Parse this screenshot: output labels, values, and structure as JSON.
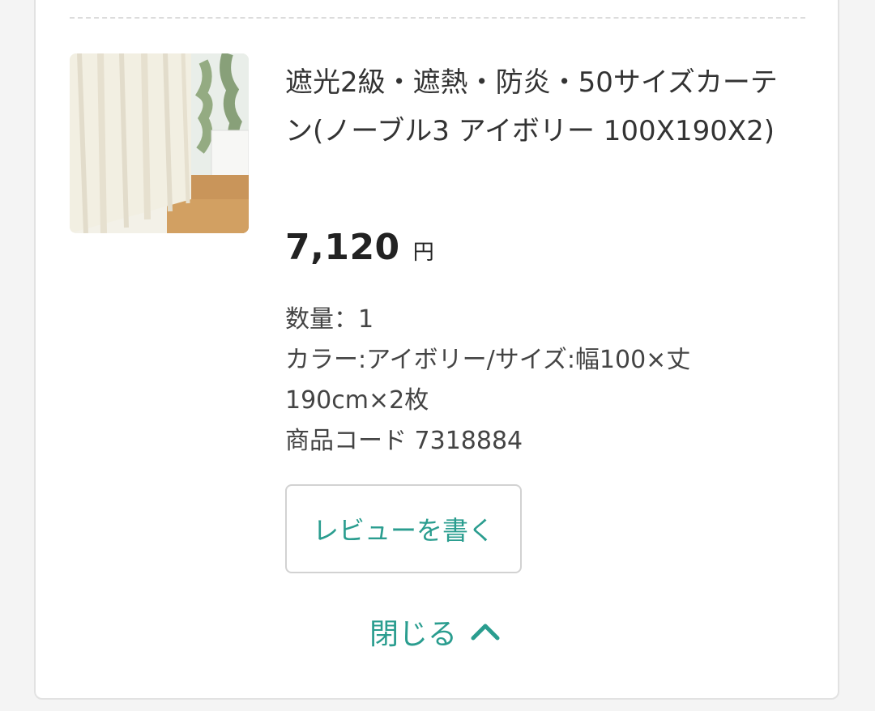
{
  "product": {
    "title": "遮光2級・遮熱・防炎・50サイズカーテン(ノーブル3 アイボリー 100X190X2)",
    "price": "7,120",
    "currency": "円",
    "quantity": "数量：1",
    "variant": "カラー:アイボリー/サイズ:幅100×丈190cm×2枚",
    "code": "商品コード 7318884"
  },
  "actions": {
    "review_label": "レビューを書く",
    "close_label": "閉じる"
  },
  "colors": {
    "accent": "#2a9d8f"
  },
  "icons": {
    "close": "chevron-up-icon"
  }
}
